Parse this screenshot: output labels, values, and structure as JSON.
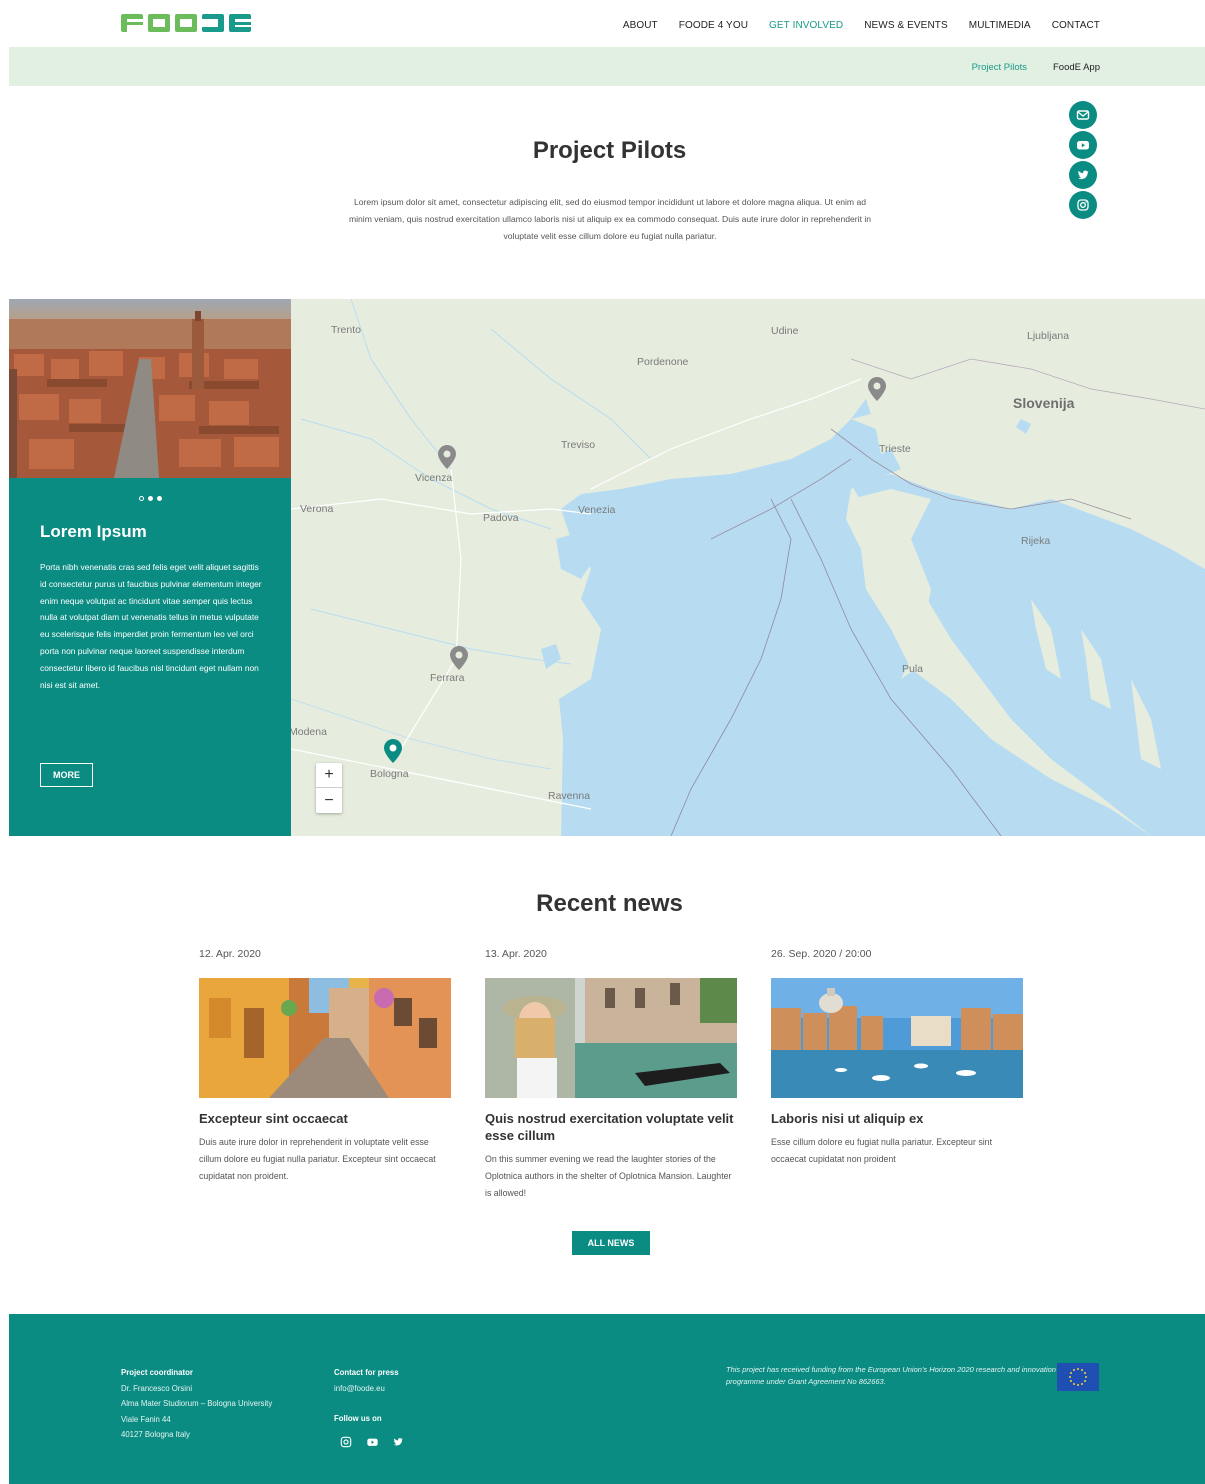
{
  "header": {
    "logo_text": "FOODE",
    "nav": [
      {
        "label": "ABOUT"
      },
      {
        "label": "FOODE 4 YOU"
      },
      {
        "label": "GET INVOLVED",
        "active": true
      },
      {
        "label": "NEWS & EVENTS"
      },
      {
        "label": "MULTIMEDIA"
      },
      {
        "label": "CONTACT"
      }
    ],
    "subnav": [
      {
        "label": "Project Pilots",
        "active": true
      },
      {
        "label": "FoodE App"
      }
    ]
  },
  "social_icons": [
    "mail-icon",
    "youtube-icon",
    "twitter-icon",
    "instagram-icon"
  ],
  "intro": {
    "title": "Project Pilots",
    "text": "Lorem ipsum dolor sit amet, consectetur adipiscing elit, sed do eiusmod tempor incididunt ut labore et dolore magna aliqua. Ut enim ad minim veniam, quis nostrud exercitation ullamco laboris nisi ut aliquip ex ea commodo consequat. Duis aute irure dolor in reprehenderit in voluptate velit esse cillum dolore eu fugiat nulla pariatur."
  },
  "pilot_panel": {
    "title": "Lorem Ipsum",
    "text": "Porta nibh venenatis cras sed felis eget velit aliquet sagittis id consectetur purus ut faucibus pulvinar elementum integer enim neque volutpat ac tincidunt vitae semper quis lectus nulla at volutpat diam ut venenatis tellus in metus vulputate eu scelerisque felis imperdiet proin fermentum leo vel orci porta non pulvinar neque laoreet suspendisse interdum consectetur libero id faucibus nisl tincidunt eget nullam non nisi est sit amet.",
    "more_label": "MORE",
    "slide_dots": 3,
    "active_dot": 0
  },
  "map": {
    "labels": {
      "trento": "Trento",
      "udine": "Udine",
      "ljubljana": "Ljubljana",
      "pordenone": "Pordenone",
      "slovenija": "Slovenija",
      "treviso": "Treviso",
      "trieste": "Trieste",
      "vicenza": "Vicenza",
      "verona": "Verona",
      "padova": "Padova",
      "venezia": "Venezia",
      "rijeka": "Rijeka",
      "ferrara": "Ferrara",
      "pula": "Pula",
      "modena": "Modena",
      "bologna": "Bologna",
      "ravenna": "Ravenna"
    },
    "zoom_in": "+",
    "zoom_out": "−",
    "colors": {
      "land": "#e6eddf",
      "water": "#b7dcf2",
      "pin_grey": "#8a8a8a",
      "pin_active": "#0a8c83"
    }
  },
  "news": {
    "title": "Recent news",
    "items": [
      {
        "date": "12. Apr. 2020",
        "headline": "Excepteur sint occaecat",
        "body": "Duis aute irure dolor in reprehenderit in voluptate velit esse cillum dolore eu fugiat nulla pariatur. Excepteur sint occaecat cupidatat non proident."
      },
      {
        "date": "13. Apr. 2020",
        "headline": "Quis nostrud exercitation voluptate velit esse cillum",
        "body": "On this summer evening we read the laughter stories of the Oplotnica authors in the shelter of Oplotnica Mansion. Laughter is allowed!"
      },
      {
        "date": "26. Sep. 2020  /  20:00",
        "headline": "Laboris nisi ut aliquip ex",
        "body": "Esse cillum dolore eu fugiat nulla pariatur. Excepteur sint occaecat cupidatat non proident"
      }
    ],
    "all_news_label": "ALL NEWS"
  },
  "footer": {
    "coordinator": {
      "heading": "Project coordinator",
      "lines": [
        "Dr. Francesco Orsini",
        "Alma Mater Studiorum – Bologna University",
        "Viale Fanin 44",
        "40127 Bologna Italy"
      ]
    },
    "press": {
      "heading": "Contact for press",
      "email": "info@foode.eu",
      "follow": "Follow us on"
    },
    "funding": "This project has received funding from the European Union's Horizon 2020 research and innovation programme under Grant Agreement No 862663.",
    "accent": "#0a8c83"
  }
}
